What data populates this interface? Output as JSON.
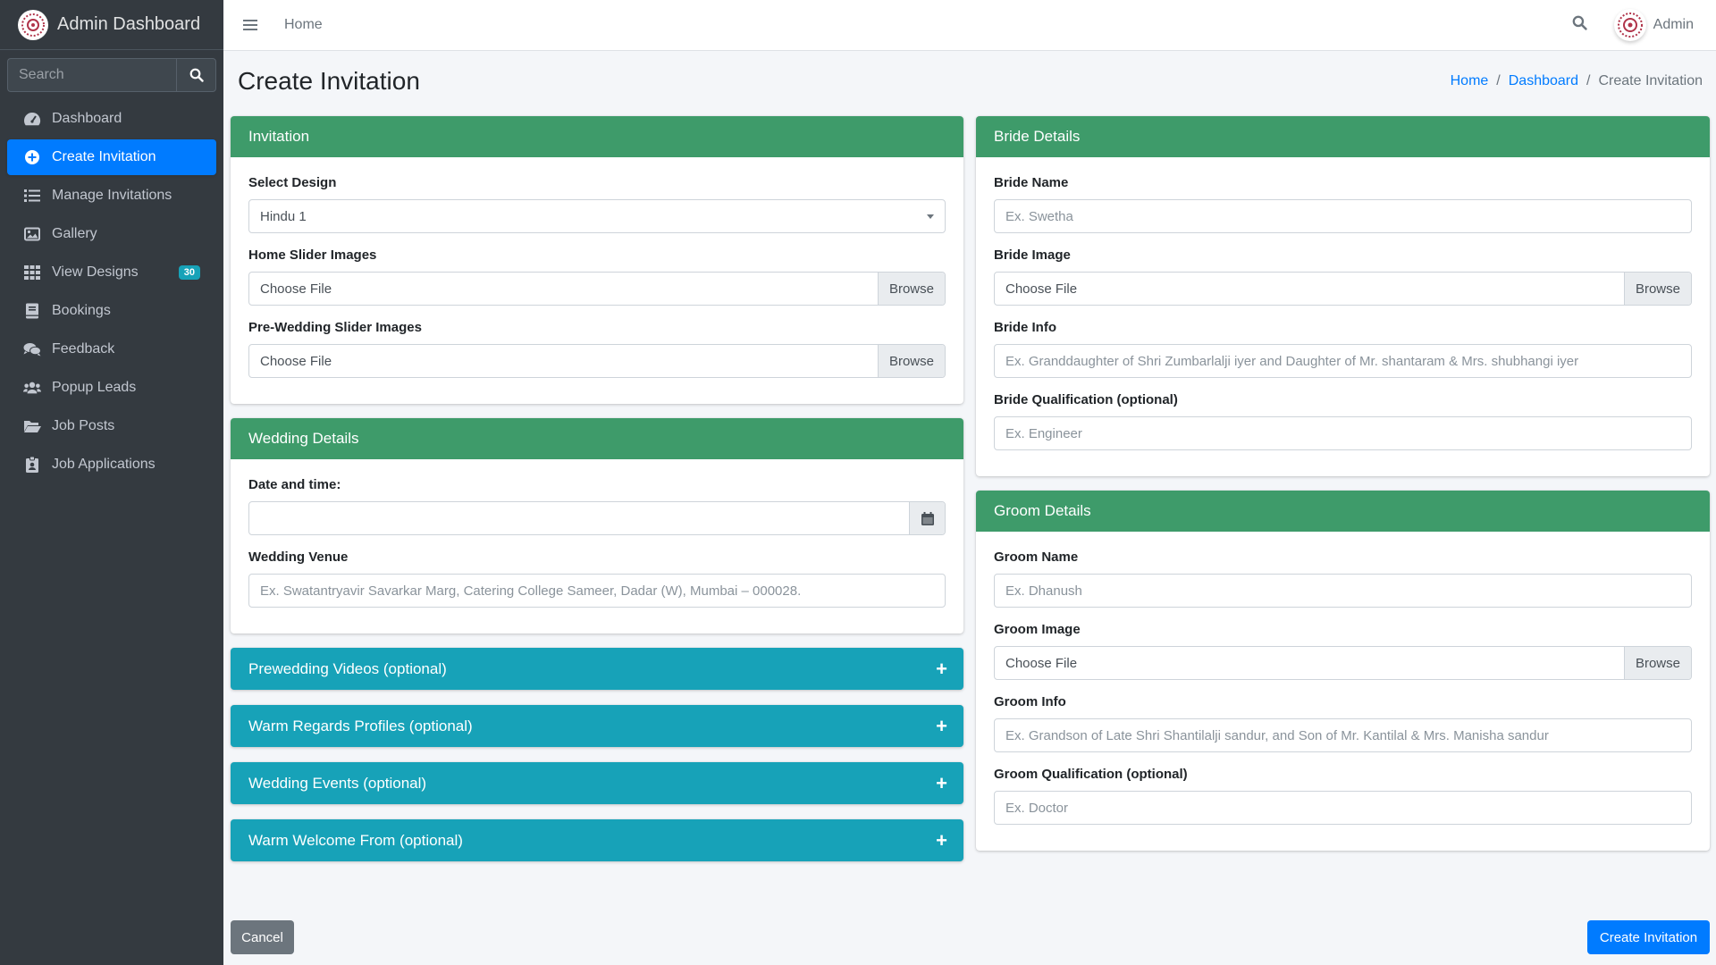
{
  "app": {
    "title": "Admin Dashboard"
  },
  "sidebar": {
    "search_placeholder": "Search",
    "items": [
      {
        "label": "Dashboard",
        "icon": "dashboard-icon"
      },
      {
        "label": "Create Invitation",
        "icon": "plus-circle-icon",
        "active": true
      },
      {
        "label": "Manage Invitations",
        "icon": "list-icon"
      },
      {
        "label": "Gallery",
        "icon": "image-icon"
      },
      {
        "label": "View Designs",
        "icon": "grid-icon",
        "badge": "30"
      },
      {
        "label": "Bookings",
        "icon": "book-icon"
      },
      {
        "label": "Feedback",
        "icon": "comments-icon"
      },
      {
        "label": "Popup Leads",
        "icon": "users-icon"
      },
      {
        "label": "Job Posts",
        "icon": "folder-icon"
      },
      {
        "label": "Job Applications",
        "icon": "id-badge-icon"
      }
    ]
  },
  "topbar": {
    "home": "Home",
    "user": "Admin"
  },
  "header": {
    "title": "Create Invitation",
    "breadcrumb": [
      "Home",
      "Dashboard",
      "Create Invitation"
    ]
  },
  "invitation": {
    "title": "Invitation",
    "design_label": "Select Design",
    "design_value": "Hindu 1",
    "home_slider_label": "Home Slider Images",
    "prewedding_slider_label": "Pre-Wedding Slider Images",
    "choose_file": "Choose File",
    "browse": "Browse"
  },
  "wedding": {
    "title": "Wedding Details",
    "date_label": "Date and time:",
    "venue_label": "Wedding Venue",
    "venue_placeholder": "Ex. Swatantryavir Savarkar Marg, Catering College Sameer, Dadar (W), Mumbai – 000028."
  },
  "collapsibles": [
    "Prewedding Videos (optional)",
    "Warm Regards Profiles (optional)",
    "Wedding Events (optional)",
    "Warm Welcome From (optional)"
  ],
  "bride": {
    "title": "Bride Details",
    "name_label": "Bride Name",
    "name_placeholder": "Ex. Swetha",
    "image_label": "Bride Image",
    "info_label": "Bride Info",
    "info_placeholder": "Ex. Granddaughter of Shri Zumbarlalji iyer and Daughter of Mr. shantaram & Mrs. shubhangi iyer",
    "qual_label": "Bride Qualification (optional)",
    "qual_placeholder": "Ex. Engineer"
  },
  "groom": {
    "title": "Groom Details",
    "name_label": "Groom Name",
    "name_placeholder": "Ex. Dhanush",
    "image_label": "Groom Image",
    "info_label": "Groom Info",
    "info_placeholder": "Ex. Grandson of Late Shri Shantilalji sandur, and Son of Mr. Kantilal & Mrs. Manisha sandur",
    "qual_label": "Groom Qualification (optional)",
    "qual_placeholder": "Ex. Doctor"
  },
  "actions": {
    "cancel": "Cancel",
    "create": "Create Invitation"
  },
  "colors": {
    "primary": "#007bff",
    "card_header": "#3e9b6a",
    "info": "#17a2b8",
    "sidebar": "#343a40"
  }
}
